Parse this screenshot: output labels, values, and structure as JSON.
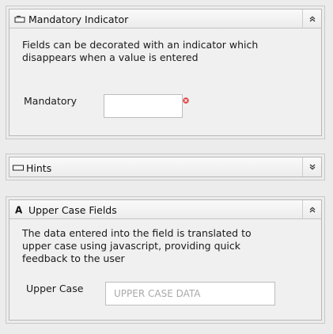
{
  "colors": {
    "page_background": "#ececec",
    "panel_background": "#f0f0f0",
    "panel_border": "#b8b8b8",
    "required_indicator": "#e03a3a"
  },
  "mandatory_panel": {
    "title": "Mandatory Indicator",
    "icon": "form-icon",
    "toggle_icon": "collapse-icon",
    "description": "Fields can be decorated with an indicator which disappears when a value is entered",
    "field_label": "Mandatory",
    "field_value": "",
    "field_placeholder": "",
    "indicator_icon": "required-indicator-icon"
  },
  "hints_panel": {
    "title": "Hints",
    "icon": "textbox-icon",
    "toggle_icon": "expand-icon"
  },
  "uppercase_panel": {
    "title": "Upper Case Fields",
    "icon": "letter-a-icon",
    "toggle_icon": "collapse-icon",
    "description": "The data entered into the field is translated to upper case using javascript, providing quick feedback to the user",
    "field_label": "Upper Case",
    "field_value": "",
    "field_placeholder": "UPPER CASE DATA"
  }
}
